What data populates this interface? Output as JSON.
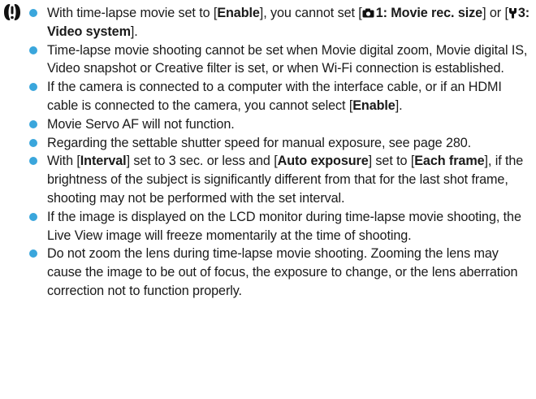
{
  "colors": {
    "bullet": "#3aa6dc",
    "text": "#1a1a1a"
  },
  "icons": {
    "caution": "caution-icon",
    "camera": "camera-shooting-tab-icon",
    "setup": "setup-wrench-tab-icon"
  },
  "note1": {
    "p1": "With time-lapse movie set to [",
    "enable": "Enable",
    "p2": "], you cannot set [",
    "movie_rec": "1: Movie rec. size",
    "p3": "] or [",
    "video_system": "3: Video system",
    "p4": "]."
  },
  "note2": "Time-lapse movie shooting cannot be set when Movie digital zoom, Movie digital IS, Video snapshot or Creative filter is set, or when Wi-Fi connection is established.",
  "note3": {
    "p1": "If the camera is connected to a computer with the interface cable, or if an HDMI cable is connected to the camera, you cannot select [",
    "enable": "Enable",
    "p2": "]."
  },
  "note4": "Movie Servo AF will not function.",
  "note5": "Regarding the settable shutter speed for manual exposure, see page 280.",
  "note6": {
    "p1": "With [",
    "interval": "Interval",
    "p2": "] set to 3 sec. or less and [",
    "auto_exposure": "Auto exposure",
    "p3": "] set to [",
    "each_frame": "Each frame",
    "p4": "], if the brightness of the subject is significantly different from that for the last shot frame, shooting may not be performed with the set interval."
  },
  "note7": "If the image is displayed on the LCD monitor during time-lapse movie shooting, the Live View image will freeze momentarily at the time of shooting.",
  "note8": "Do not zoom the lens during time-lapse movie shooting. Zooming the lens may cause the image to be out of focus, the exposure to change, or the lens aberration correction not to function properly."
}
